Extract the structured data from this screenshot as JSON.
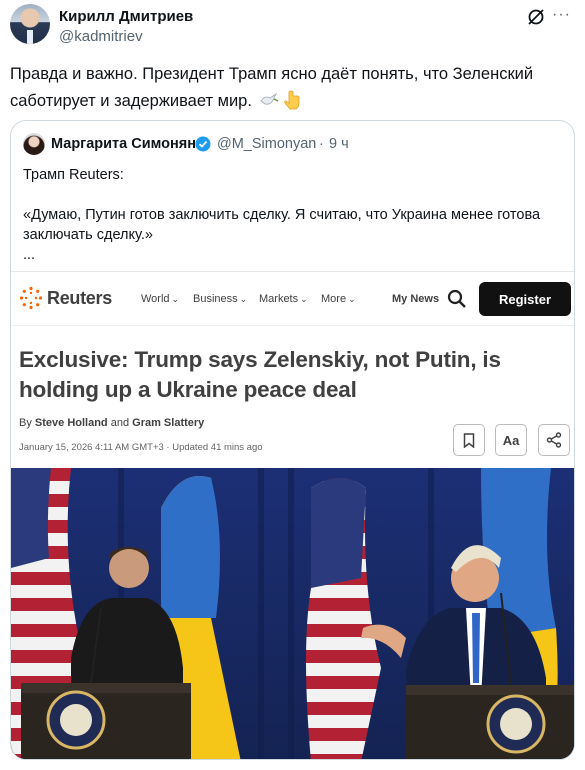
{
  "tweet": {
    "author_name": "Кирилл Дмитриев",
    "author_handle": "@kadmitriev",
    "text": "Правда и важно. Президент Трамп ясно даёт понять, что Зеленский саботирует и задерживает мир.",
    "icons": [
      "grok-icon",
      "more-icon",
      "dove-emoji",
      "pointing-down-emoji"
    ]
  },
  "quoted": {
    "author_name": "Маргарита Симонян",
    "author_handle": "@M_Simonyan",
    "separator": "·",
    "time": "9 ч",
    "line1": "Трамп Reuters:",
    "line2": "«Думаю, Путин готов заключить сделку. Я считаю, что Украина менее готова заключать сделку.»",
    "line3": "..."
  },
  "article": {
    "brand": "Reuters",
    "nav": [
      "World",
      "Business",
      "Markets",
      "More"
    ],
    "my_news": "My News",
    "register": "Register",
    "headline": "Exclusive: Trump says Zelenskiy, not Putin, is holding up a Ukraine peace deal",
    "by": "By",
    "author1": "Steve Holland",
    "and": "and",
    "author2": "Gram Slattery",
    "date": "January 15, 2026 4:11 AM GMT+3 · Updated 41 mins ago",
    "text_size_label": "Aa"
  },
  "colors": {
    "reuters_orange": "#fa6400",
    "verified_blue": "#1d9bf0",
    "text_primary": "#0f1419",
    "text_secondary": "#536471"
  }
}
